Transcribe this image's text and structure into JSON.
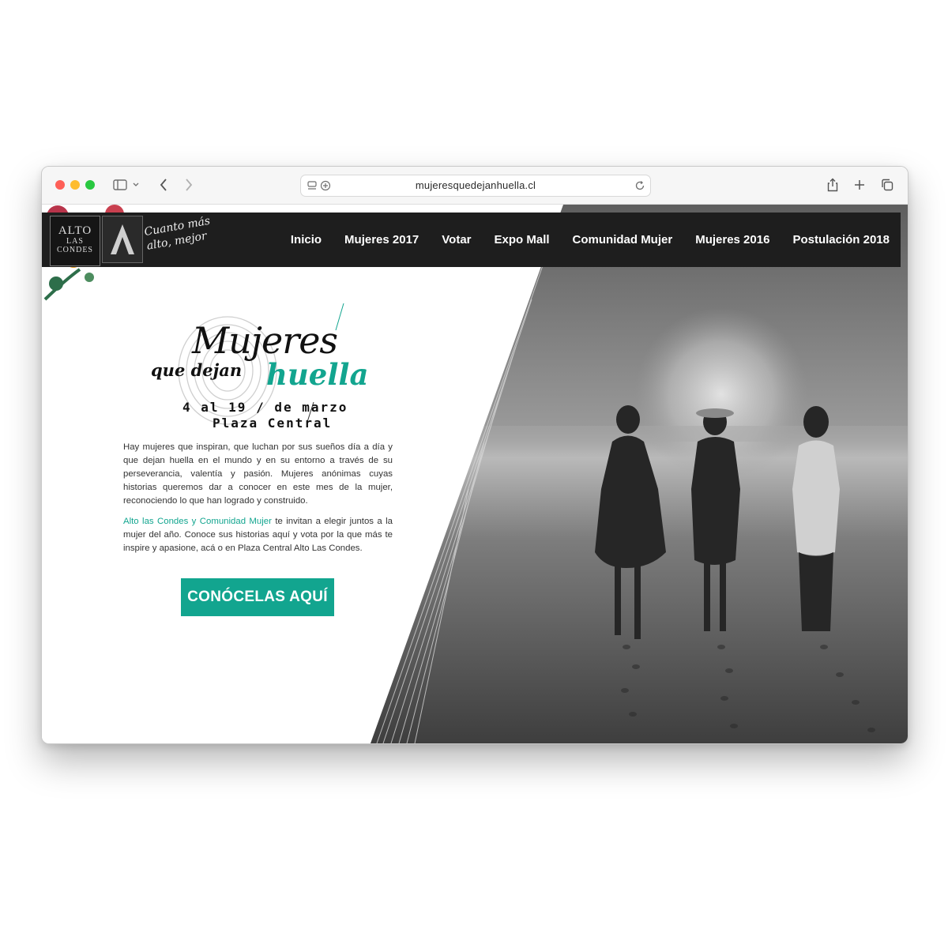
{
  "browser": {
    "url": "mujeresquedejanhuella.cl"
  },
  "nav": {
    "logo": {
      "line1": "ALTO",
      "line2": "LAS",
      "line3": "CONDES"
    },
    "tagline": "Cuanto más alto, mejor",
    "items": [
      "Inicio",
      "Mujeres 2017",
      "Votar",
      "Expo Mall",
      "Comunidad Mujer",
      "Mujeres 2016",
      "Postulación 2018"
    ]
  },
  "hero": {
    "title_top": "Mujeres",
    "title_mid": "que dejan",
    "title_accent": "huella",
    "dates": "4 al 19 / de marzo",
    "place": "Plaza Central",
    "paragraph1": "Hay mujeres que inspiran, que luchan por sus sueños día a día y que dejan huella en el mundo y en su entorno a través de su perseverancia, valentía y pasión. Mujeres anónimas cuyas historias queremos dar a conocer en este mes de la mujer, reconociendo lo que han logrado y construido.",
    "paragraph2_highlight": "Alto las Condes y Comunidad Mujer",
    "paragraph2_rest": " te invitan a elegir juntos a la mujer del año. Conoce sus historias aquí y vota por la que más te inspire y apasione, acá o en Plaza Central Alto Las Condes.",
    "cta": "CONÓCELAS AQUÍ"
  },
  "colors": {
    "accent": "#12a58f",
    "navbar": "#1e1e1e"
  }
}
